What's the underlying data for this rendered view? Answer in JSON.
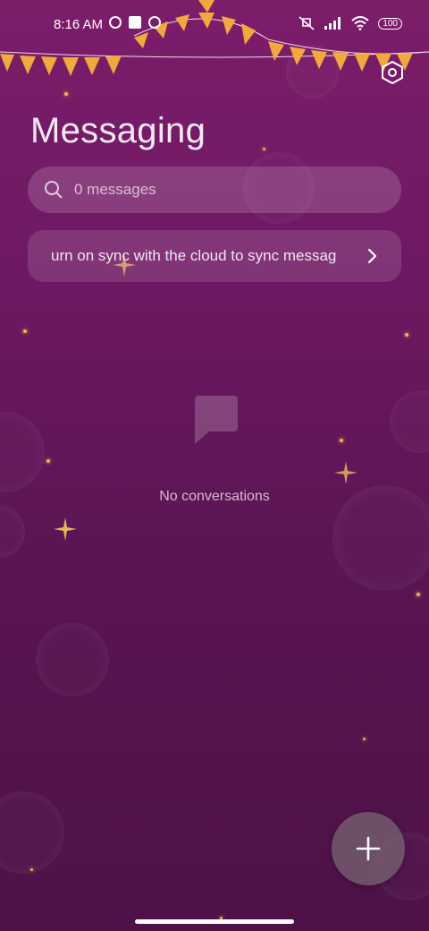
{
  "status_bar": {
    "time": "8:16 AM",
    "battery": "100"
  },
  "header": {
    "title": "Messaging"
  },
  "search": {
    "placeholder": "0 messages"
  },
  "sync_banner": {
    "text": "urn on sync with the cloud to sync messag"
  },
  "empty_state": {
    "text": "No conversations"
  },
  "icons": {
    "settings": "settings-hexagon-icon",
    "search": "search-icon",
    "chevron": "chevron-right-icon",
    "empty": "chat-bubble-icon",
    "fab": "plus-icon"
  },
  "colors": {
    "background_top": "#7c1d6a",
    "background_bottom": "#4d1247",
    "bunting_flag": "#f2a93b",
    "sparkle": "#f5b440"
  }
}
